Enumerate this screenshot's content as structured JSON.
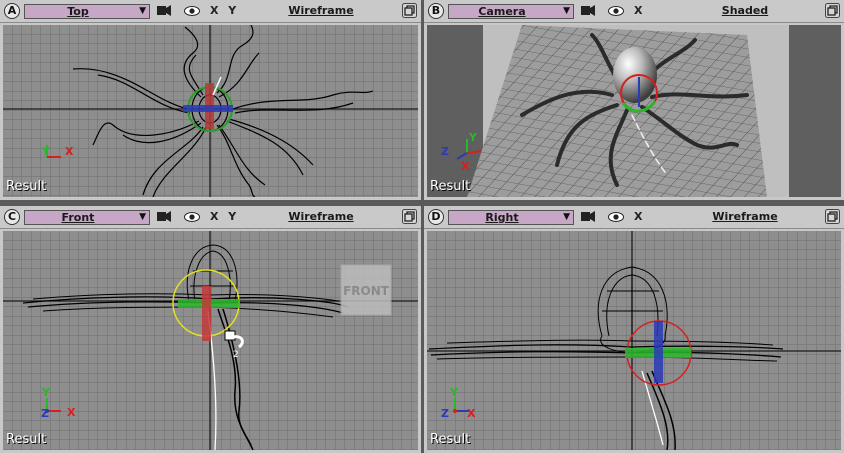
{
  "viewports": [
    {
      "letter": "A",
      "view": "Top",
      "axes": "X Y",
      "mode": "Wireframe",
      "result": "Result",
      "gizmo": {
        "x": "X",
        "y": "Y"
      }
    },
    {
      "letter": "B",
      "view": "Camera",
      "axes": "X",
      "mode": "Shaded",
      "result": "Result",
      "gizmo": {
        "x": "X",
        "y": "Y",
        "z": "Z"
      }
    },
    {
      "letter": "C",
      "view": "Front",
      "axes": "X Y",
      "mode": "Wireframe",
      "result": "Result",
      "gizmo": {
        "x": "X",
        "y": "Y",
        "z": "Z"
      },
      "label_3d": "FRONT"
    },
    {
      "letter": "D",
      "view": "Right",
      "axes": "X",
      "mode": "Wireframe",
      "result": "Result",
      "gizmo": {
        "x": "X",
        "y": "Y",
        "z": "Z"
      }
    }
  ],
  "icons": [
    "camera-icon",
    "eye-icon",
    "maximize-icon",
    "dropdown-arrow-icon"
  ]
}
